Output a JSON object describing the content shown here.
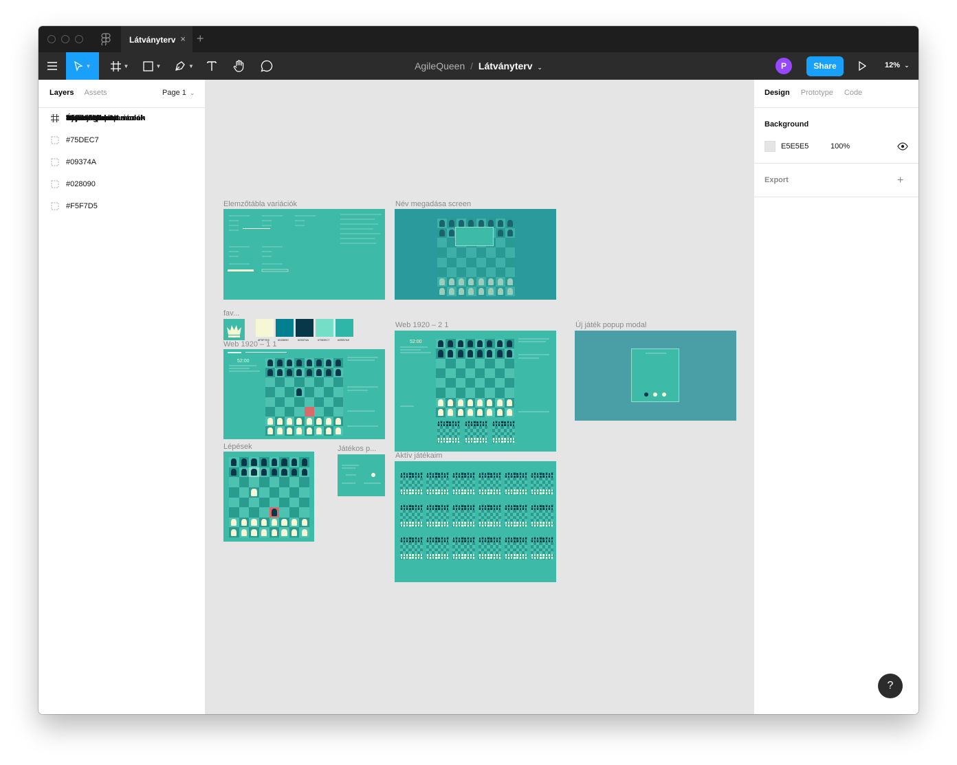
{
  "titlebar": {
    "tab_title": "Látványterv",
    "tab_close": "×",
    "new_tab": "+"
  },
  "toolbar": {
    "project": "AgileQueen",
    "separator": "/",
    "file": "Látványterv",
    "avatar_initial": "P",
    "share_label": "Share",
    "zoom": "12%"
  },
  "left_panel": {
    "tabs": [
      "Layers",
      "Assets"
    ],
    "page_selector": "Page 1",
    "layers": [
      {
        "name": "Játékos panel",
        "type": "frame"
      },
      {
        "name": "Elemzőtábla variációk",
        "type": "frame"
      },
      {
        "name": "Új játék popup modal",
        "type": "frame"
      },
      {
        "name": "Aktív játékaim",
        "type": "frame"
      },
      {
        "name": "Web 1920 – 2 1",
        "type": "frame"
      },
      {
        "name": "Lépések",
        "type": "frame"
      },
      {
        "name": "Név megadása screen",
        "type": "frame"
      },
      {
        "name": "Web 1920 – 1 1",
        "type": "frame"
      },
      {
        "name": "favicon",
        "type": "frame"
      },
      {
        "name": "#2EB7A9",
        "type": "rect"
      },
      {
        "name": "#75DEC7",
        "type": "rect"
      },
      {
        "name": "#09374A",
        "type": "rect"
      },
      {
        "name": "#028090",
        "type": "rect"
      },
      {
        "name": "#F5F7D5",
        "type": "rect"
      }
    ]
  },
  "right_panel": {
    "tabs": [
      "Design",
      "Prototype",
      "Code"
    ],
    "background_label": "Background",
    "background_hex": "E5E5E5",
    "background_opacity": "100%",
    "export_label": "Export",
    "help": "?"
  },
  "canvas": {
    "frames": [
      {
        "label": "Elemzőtábla variációk",
        "color": "#3dbaa8"
      },
      {
        "label": "Név megadása screen",
        "color": "#2b9a9c"
      },
      {
        "label": "fav...",
        "color": "#3dbaa8"
      },
      {
        "label": "Web 1920 – 1 1",
        "color": "#3dbaa8"
      },
      {
        "label": "Web 1920 – 2 1",
        "color": "#3dbaa8"
      },
      {
        "label": "Új játék popup modal",
        "color": "#4a9ea6"
      },
      {
        "label": "Lépések",
        "color": "#3dbaa8"
      },
      {
        "label": "Játékos p...",
        "color": "#3dbaa8"
      },
      {
        "label": "Aktív játékaim",
        "color": "#3dbaa8"
      }
    ],
    "swatches": [
      {
        "hex": "#F5F7D5",
        "label": "#F5F7D5"
      },
      {
        "hex": "#028090",
        "label": "#028090"
      },
      {
        "hex": "#09374A",
        "label": "#09374A"
      },
      {
        "hex": "#75DEC7",
        "label": "#75DEC7"
      },
      {
        "hex": "#2EB7A9",
        "label": "#2EB7A9"
      }
    ]
  },
  "colors": {
    "accent": "#18A0FB",
    "board_light": "#4ec2b0",
    "board_dark": "#2a9c8f",
    "piece_dark": "#09374A",
    "piece_light": "#F5F7D5"
  }
}
